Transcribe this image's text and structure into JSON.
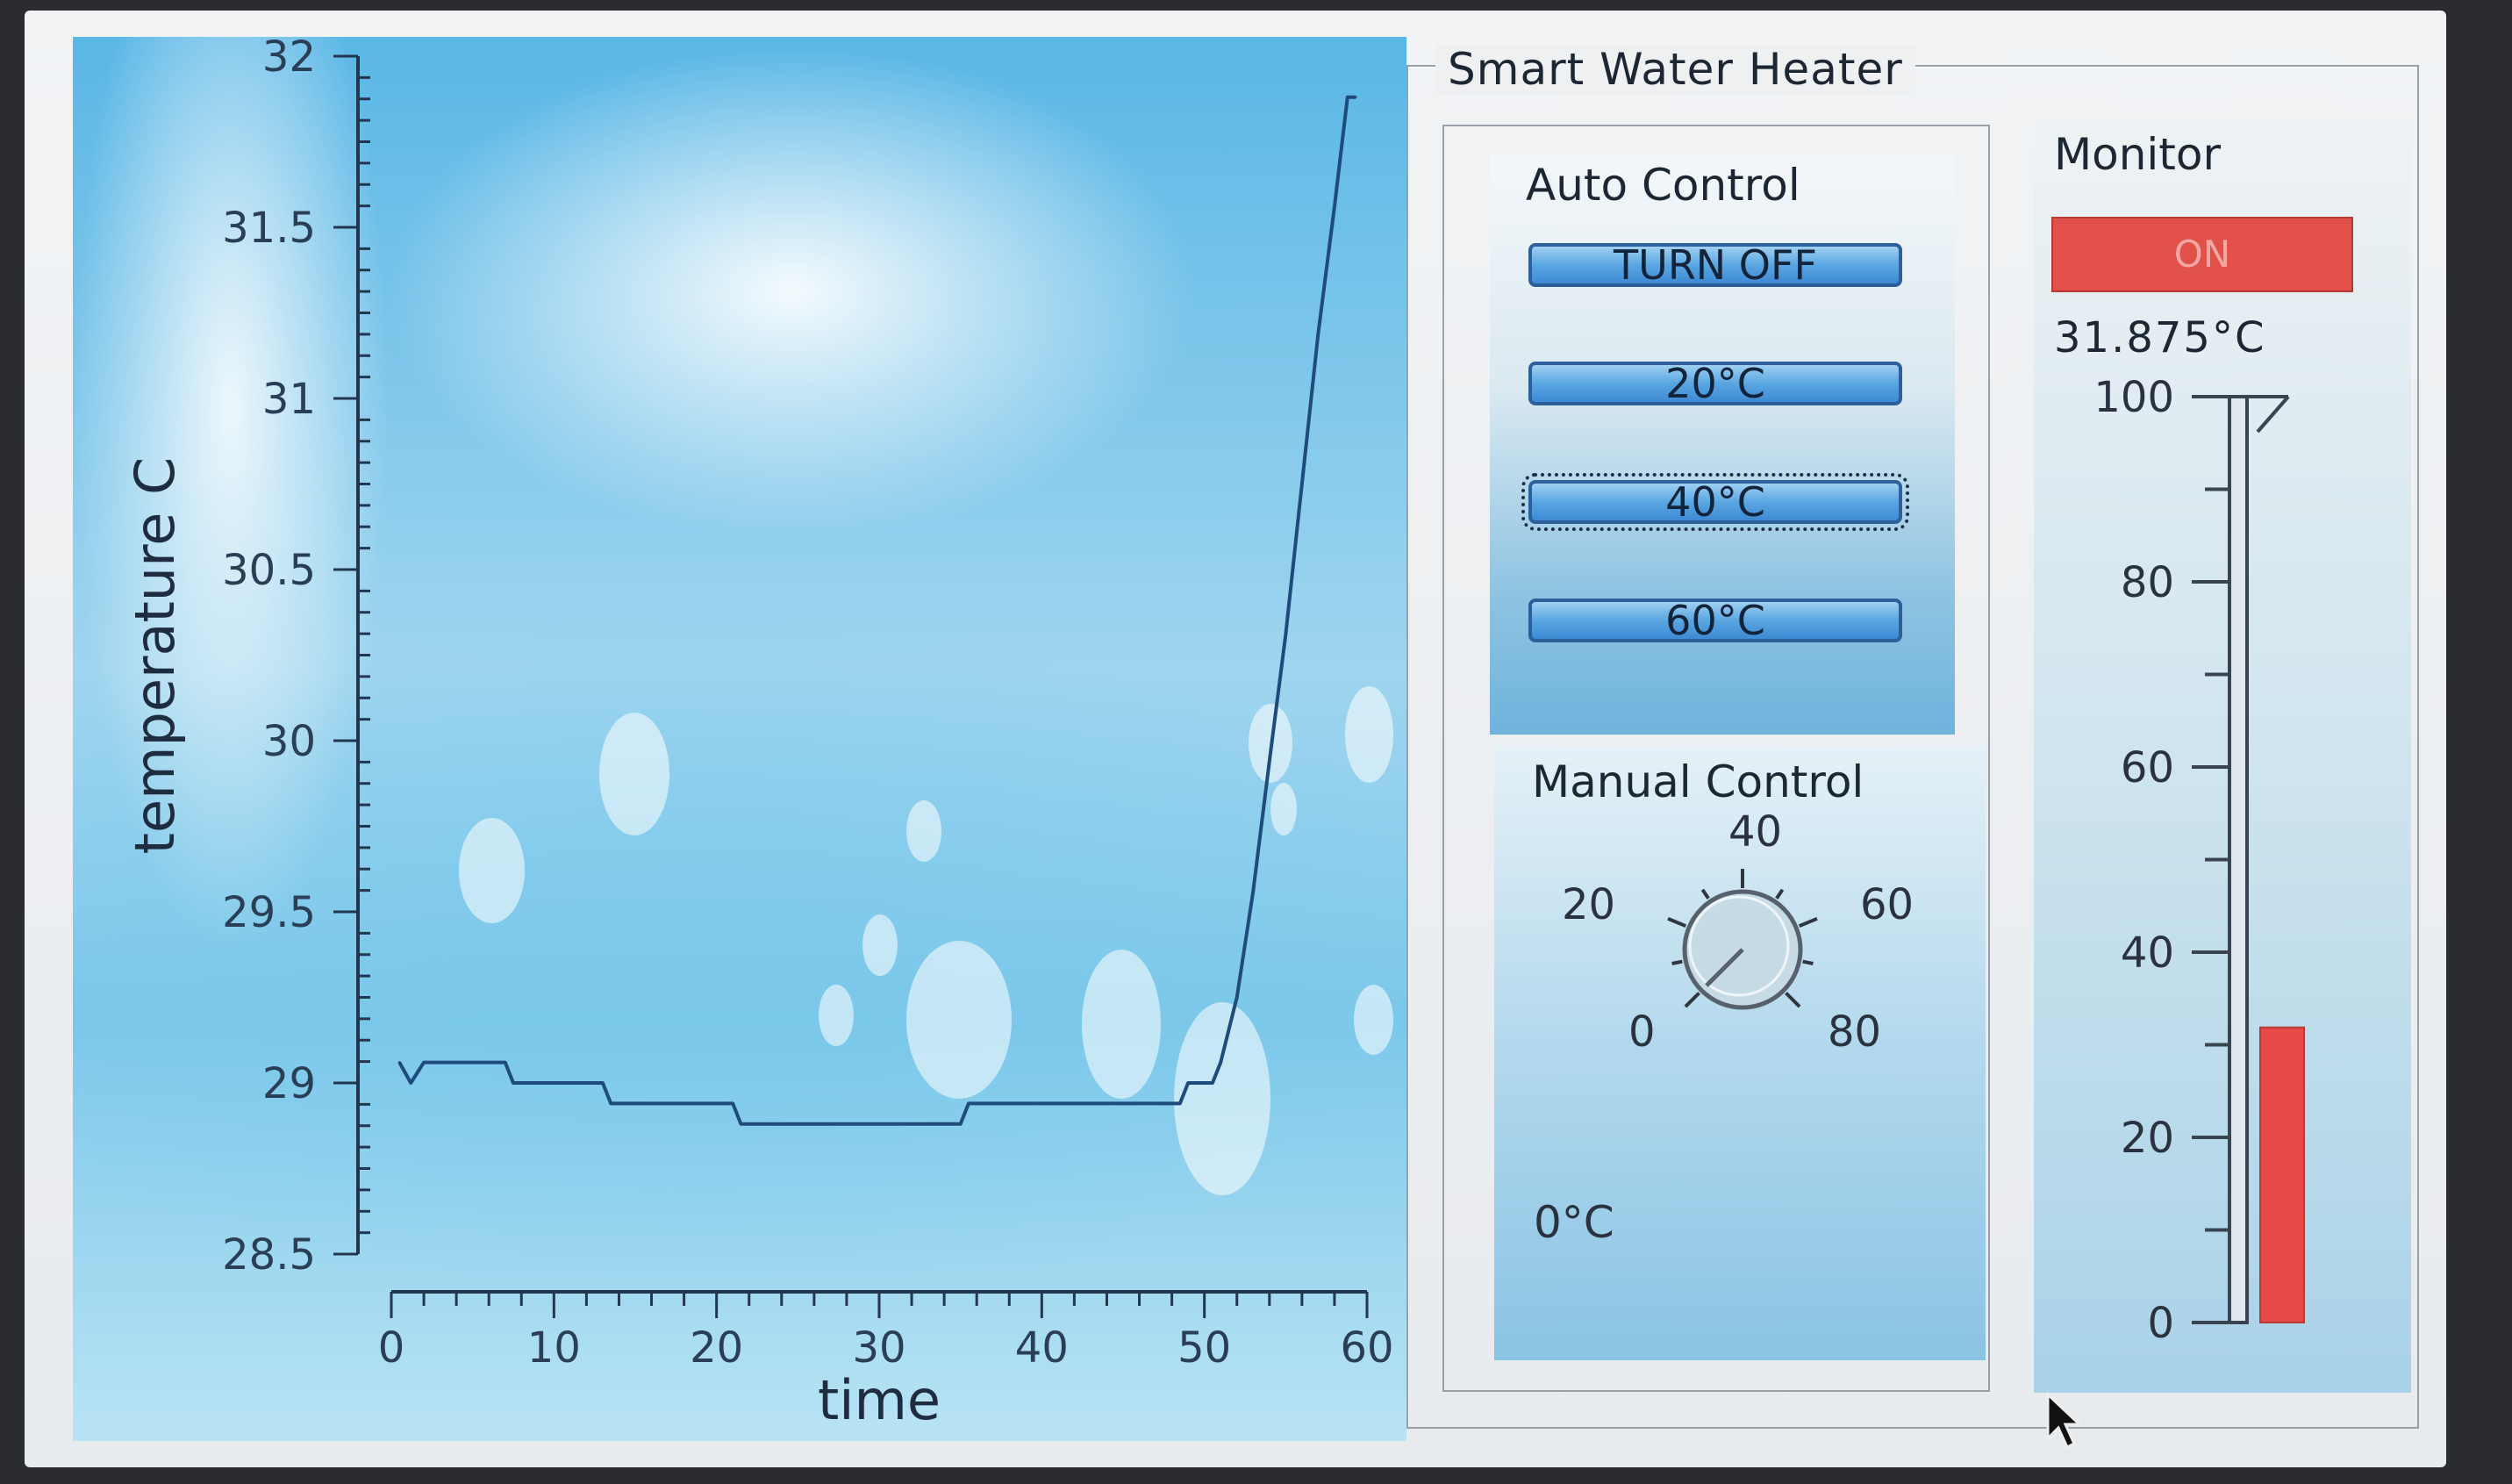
{
  "chart_data": {
    "type": "line",
    "title": "",
    "xlabel": "time",
    "ylabel": "temperature C",
    "xlim": [
      0,
      60
    ],
    "ylim": [
      28.5,
      32
    ],
    "xticks": [
      0,
      10,
      20,
      30,
      40,
      50,
      60
    ],
    "yticks": [
      28.5,
      29,
      29.5,
      30,
      30.5,
      31,
      31.5,
      32
    ],
    "ytick_labels": [
      "28.5",
      "29",
      "29.5",
      "30",
      "30.5",
      "31",
      "31.5",
      "32"
    ],
    "xtick_labels": [
      "0",
      "10",
      "20",
      "30",
      "40",
      "50",
      "60"
    ],
    "series": [
      {
        "x": [
          0.5,
          1.2,
          2.0,
          2.5,
          7.0,
          7.5,
          13.0,
          13.5,
          21.0,
          21.5,
          35.0,
          35.5,
          48.5,
          49.0,
          50.5,
          51.0,
          52.0,
          53.0,
          54.0,
          55.0,
          56.0,
          57.0,
          58.0,
          58.8,
          59.3
        ],
        "y": [
          29.06,
          29.0,
          29.06,
          29.06,
          29.06,
          29.0,
          29.0,
          28.94,
          28.94,
          28.88,
          28.88,
          28.94,
          28.94,
          29.0,
          29.0,
          29.06,
          29.25,
          29.56,
          29.94,
          30.31,
          30.75,
          31.19,
          31.56,
          31.88,
          31.88
        ]
      }
    ],
    "grid": false
  },
  "heater": {
    "group_title": "Smart Water Heater",
    "auto_control": {
      "title": "Auto Control",
      "buttons": [
        "TURN OFF",
        "20°C",
        "40°C",
        "60°C"
      ]
    },
    "manual_control": {
      "title": "Manual Control",
      "dial_labels": [
        "0",
        "20",
        "40",
        "60",
        "80"
      ],
      "dial_value": 0,
      "value_text": "0°C"
    },
    "monitor": {
      "title": "Monitor",
      "status_text": "ON",
      "status_color": "#e2504a",
      "temperature_text": "31.875°C",
      "thermo_ticks": [
        "0",
        "20",
        "40",
        "60",
        "80",
        "100"
      ],
      "thermo_value": 31.875,
      "thermo_max": 100,
      "fill_color": "#e64a47"
    }
  }
}
